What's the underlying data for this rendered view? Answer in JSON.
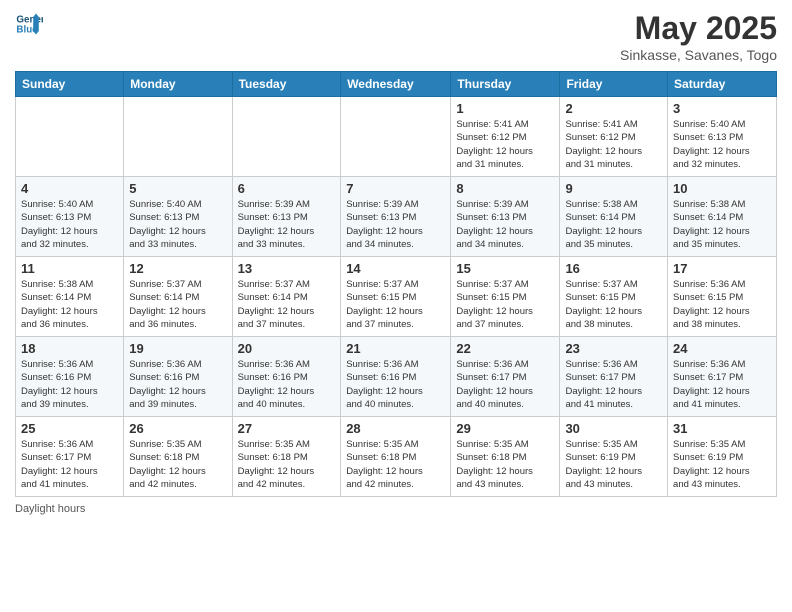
{
  "header": {
    "logo_line1": "General",
    "logo_line2": "Blue",
    "title": "May 2025",
    "subtitle": "Sinkasse, Savanes, Togo"
  },
  "days_of_week": [
    "Sunday",
    "Monday",
    "Tuesday",
    "Wednesday",
    "Thursday",
    "Friday",
    "Saturday"
  ],
  "weeks": [
    [
      {
        "day": "",
        "info": ""
      },
      {
        "day": "",
        "info": ""
      },
      {
        "day": "",
        "info": ""
      },
      {
        "day": "",
        "info": ""
      },
      {
        "day": "1",
        "info": "Sunrise: 5:41 AM\nSunset: 6:12 PM\nDaylight: 12 hours\nand 31 minutes."
      },
      {
        "day": "2",
        "info": "Sunrise: 5:41 AM\nSunset: 6:12 PM\nDaylight: 12 hours\nand 31 minutes."
      },
      {
        "day": "3",
        "info": "Sunrise: 5:40 AM\nSunset: 6:13 PM\nDaylight: 12 hours\nand 32 minutes."
      }
    ],
    [
      {
        "day": "4",
        "info": "Sunrise: 5:40 AM\nSunset: 6:13 PM\nDaylight: 12 hours\nand 32 minutes."
      },
      {
        "day": "5",
        "info": "Sunrise: 5:40 AM\nSunset: 6:13 PM\nDaylight: 12 hours\nand 33 minutes."
      },
      {
        "day": "6",
        "info": "Sunrise: 5:39 AM\nSunset: 6:13 PM\nDaylight: 12 hours\nand 33 minutes."
      },
      {
        "day": "7",
        "info": "Sunrise: 5:39 AM\nSunset: 6:13 PM\nDaylight: 12 hours\nand 34 minutes."
      },
      {
        "day": "8",
        "info": "Sunrise: 5:39 AM\nSunset: 6:13 PM\nDaylight: 12 hours\nand 34 minutes."
      },
      {
        "day": "9",
        "info": "Sunrise: 5:38 AM\nSunset: 6:14 PM\nDaylight: 12 hours\nand 35 minutes."
      },
      {
        "day": "10",
        "info": "Sunrise: 5:38 AM\nSunset: 6:14 PM\nDaylight: 12 hours\nand 35 minutes."
      }
    ],
    [
      {
        "day": "11",
        "info": "Sunrise: 5:38 AM\nSunset: 6:14 PM\nDaylight: 12 hours\nand 36 minutes."
      },
      {
        "day": "12",
        "info": "Sunrise: 5:37 AM\nSunset: 6:14 PM\nDaylight: 12 hours\nand 36 minutes."
      },
      {
        "day": "13",
        "info": "Sunrise: 5:37 AM\nSunset: 6:14 PM\nDaylight: 12 hours\nand 37 minutes."
      },
      {
        "day": "14",
        "info": "Sunrise: 5:37 AM\nSunset: 6:15 PM\nDaylight: 12 hours\nand 37 minutes."
      },
      {
        "day": "15",
        "info": "Sunrise: 5:37 AM\nSunset: 6:15 PM\nDaylight: 12 hours\nand 37 minutes."
      },
      {
        "day": "16",
        "info": "Sunrise: 5:37 AM\nSunset: 6:15 PM\nDaylight: 12 hours\nand 38 minutes."
      },
      {
        "day": "17",
        "info": "Sunrise: 5:36 AM\nSunset: 6:15 PM\nDaylight: 12 hours\nand 38 minutes."
      }
    ],
    [
      {
        "day": "18",
        "info": "Sunrise: 5:36 AM\nSunset: 6:16 PM\nDaylight: 12 hours\nand 39 minutes."
      },
      {
        "day": "19",
        "info": "Sunrise: 5:36 AM\nSunset: 6:16 PM\nDaylight: 12 hours\nand 39 minutes."
      },
      {
        "day": "20",
        "info": "Sunrise: 5:36 AM\nSunset: 6:16 PM\nDaylight: 12 hours\nand 40 minutes."
      },
      {
        "day": "21",
        "info": "Sunrise: 5:36 AM\nSunset: 6:16 PM\nDaylight: 12 hours\nand 40 minutes."
      },
      {
        "day": "22",
        "info": "Sunrise: 5:36 AM\nSunset: 6:17 PM\nDaylight: 12 hours\nand 40 minutes."
      },
      {
        "day": "23",
        "info": "Sunrise: 5:36 AM\nSunset: 6:17 PM\nDaylight: 12 hours\nand 41 minutes."
      },
      {
        "day": "24",
        "info": "Sunrise: 5:36 AM\nSunset: 6:17 PM\nDaylight: 12 hours\nand 41 minutes."
      }
    ],
    [
      {
        "day": "25",
        "info": "Sunrise: 5:36 AM\nSunset: 6:17 PM\nDaylight: 12 hours\nand 41 minutes."
      },
      {
        "day": "26",
        "info": "Sunrise: 5:35 AM\nSunset: 6:18 PM\nDaylight: 12 hours\nand 42 minutes."
      },
      {
        "day": "27",
        "info": "Sunrise: 5:35 AM\nSunset: 6:18 PM\nDaylight: 12 hours\nand 42 minutes."
      },
      {
        "day": "28",
        "info": "Sunrise: 5:35 AM\nSunset: 6:18 PM\nDaylight: 12 hours\nand 42 minutes."
      },
      {
        "day": "29",
        "info": "Sunrise: 5:35 AM\nSunset: 6:18 PM\nDaylight: 12 hours\nand 43 minutes."
      },
      {
        "day": "30",
        "info": "Sunrise: 5:35 AM\nSunset: 6:19 PM\nDaylight: 12 hours\nand 43 minutes."
      },
      {
        "day": "31",
        "info": "Sunrise: 5:35 AM\nSunset: 6:19 PM\nDaylight: 12 hours\nand 43 minutes."
      }
    ]
  ],
  "footer": "Daylight hours"
}
